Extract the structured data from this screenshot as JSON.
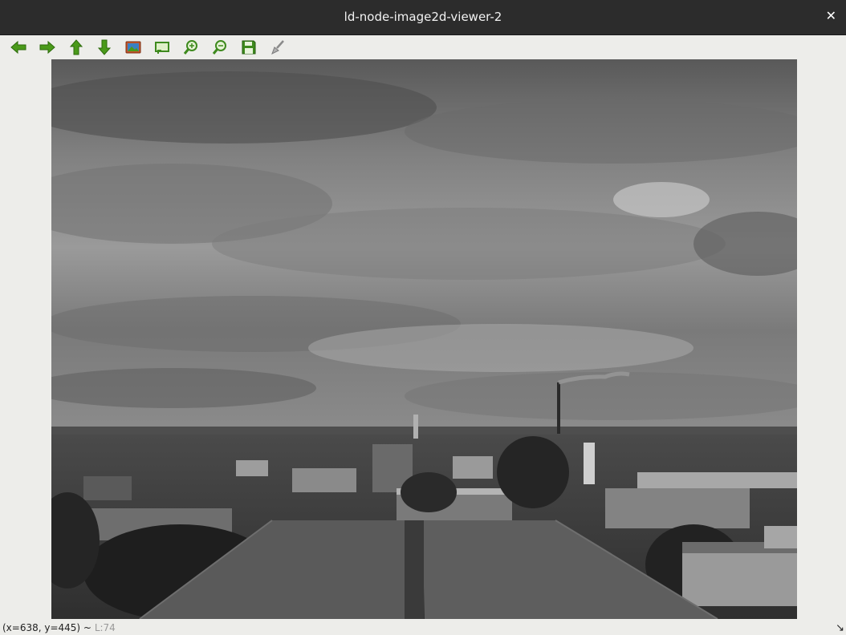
{
  "window": {
    "title": "ld-node-image2d-viewer-2",
    "close_glyph": "✕"
  },
  "toolbar": {
    "buttons": [
      {
        "name": "arrow-left-icon",
        "color": "#4a9a1a"
      },
      {
        "name": "arrow-right-icon",
        "color": "#4a9a1a"
      },
      {
        "name": "arrow-up-icon",
        "color": "#4a9a1a"
      },
      {
        "name": "arrow-down-icon",
        "color": "#4a9a1a"
      },
      {
        "name": "image-icon",
        "color": "#c8552a"
      },
      {
        "name": "fit-window-icon",
        "color": "#3e8a1e"
      },
      {
        "name": "zoom-in-icon",
        "color": "#3e8a1e"
      },
      {
        "name": "zoom-out-icon",
        "color": "#3e8a1e"
      },
      {
        "name": "save-icon",
        "color": "#3e8a1e"
      },
      {
        "name": "brush-icon",
        "color": "#8a8a8a"
      }
    ]
  },
  "status": {
    "coords": "(x=638, y=445) ~",
    "level": "L:74",
    "grip_glyph": "↘"
  }
}
